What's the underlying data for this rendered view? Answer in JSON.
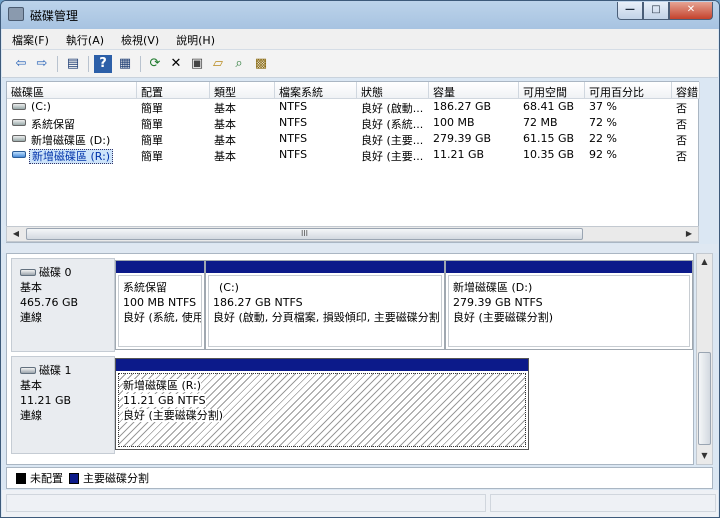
{
  "window": {
    "title": "磁碟管理",
    "icon": "disk-management-icon"
  },
  "window_buttons": {
    "minimize": "—",
    "maximize": "□",
    "close": "✕"
  },
  "menu": [
    "檔案(F)",
    "執行(A)",
    "檢視(V)",
    "說明(H)"
  ],
  "toolbar": [
    {
      "icon": "back-arrow-icon",
      "glyph": "⇦"
    },
    {
      "icon": "forward-arrow-icon",
      "glyph": "⇨"
    },
    {
      "icon": "show-hide-tree-icon",
      "glyph": "▤"
    },
    {
      "icon": "help-icon",
      "glyph": "?"
    },
    {
      "icon": "show-hide-action-icon",
      "glyph": "▦"
    },
    {
      "icon": "refresh-icon",
      "glyph": "⟳"
    },
    {
      "icon": "delete-icon",
      "glyph": "✕"
    },
    {
      "icon": "properties-icon",
      "glyph": "▣"
    },
    {
      "icon": "open-folder-icon",
      "glyph": "▱"
    },
    {
      "icon": "explore-icon",
      "glyph": "⌕"
    },
    {
      "icon": "settings-icon",
      "glyph": "▩"
    }
  ],
  "volume_columns": [
    "磁碟區",
    "配置",
    "類型",
    "檔案系統",
    "狀態",
    "容量",
    "可用空間",
    "可用百分比",
    "容錯"
  ],
  "volumes": [
    {
      "name": "(C:)",
      "layout": "簡單",
      "type": "基本",
      "fs": "NTFS",
      "status": "良好 (啟動...",
      "capacity": "186.27 GB",
      "free": "68.41 GB",
      "pct": "37 %",
      "fault": "否"
    },
    {
      "name": "系統保留",
      "layout": "簡單",
      "type": "基本",
      "fs": "NTFS",
      "status": "良好 (系統...",
      "capacity": "100 MB",
      "free": "72 MB",
      "pct": "72 %",
      "fault": "否"
    },
    {
      "name": "新增磁碟區 (D:)",
      "layout": "簡單",
      "type": "基本",
      "fs": "NTFS",
      "status": "良好 (主要...",
      "capacity": "279.39 GB",
      "free": "61.15 GB",
      "pct": "22 %",
      "fault": "否"
    },
    {
      "name": "新增磁碟區 (R:)",
      "layout": "簡單",
      "type": "基本",
      "fs": "NTFS",
      "status": "良好 (主要...",
      "capacity": "11.21 GB",
      "free": "10.35 GB",
      "pct": "92 %",
      "fault": "否"
    }
  ],
  "scrollbar": {
    "grip": "III",
    "left": "◀",
    "right": "▶",
    "up": "▲",
    "down": "▼"
  },
  "disks": [
    {
      "name": "磁碟 0",
      "type": "基本",
      "size": "465.76 GB",
      "state": "連線",
      "partitions": [
        {
          "name": "系統保留",
          "size_fs": "100 MB NTFS",
          "status": "良好 (系統, 使用"
        },
        {
          "name": "(C:)",
          "size_fs": "186.27 GB NTFS",
          "status": "良好 (啟動, 分頁檔案, 損毀傾印, 主要磁碟分割"
        },
        {
          "name": "新增磁碟區  (D:)",
          "size_fs": "279.39 GB NTFS",
          "status": "良好 (主要磁碟分割)"
        }
      ]
    },
    {
      "name": "磁碟 1",
      "type": "基本",
      "size": "11.21 GB",
      "state": "連線",
      "partitions": [
        {
          "name": "新增磁碟區  (R:)",
          "size_fs": "11.21 GB NTFS",
          "status": "良好 (主要磁碟分割)"
        }
      ]
    }
  ],
  "legend": [
    {
      "label": "未配置",
      "color": "#000000"
    },
    {
      "label": "主要磁碟分割",
      "color": "#0c1a8a"
    }
  ]
}
